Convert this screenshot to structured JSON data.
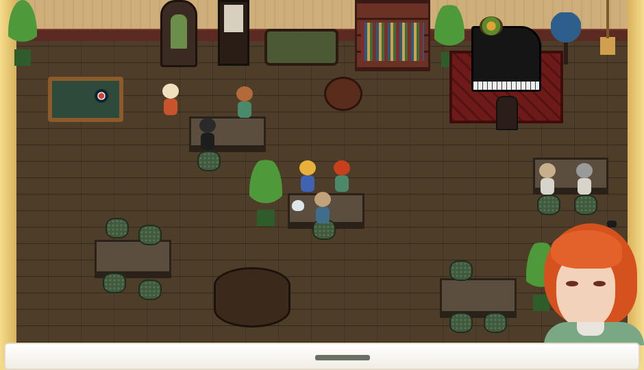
{
  "scene": {
    "name": "tavern-interior",
    "objects": [
      "jukebox",
      "menu-board",
      "sofa",
      "bookshelf",
      "potted-plant",
      "grand-piano",
      "fruit-bowl",
      "globe",
      "broom",
      "pool-table",
      "round-table",
      "barrel",
      "table",
      "stool",
      "teapot",
      "rug"
    ],
    "characters": 8
  },
  "portrait": {
    "hair_color": "#d5521f",
    "shirt_color": "#7ba884"
  },
  "message_window": {
    "text": ""
  },
  "colors": {
    "frame": "#f3d98a",
    "floor": "#4e3e29",
    "wall": "#cfae7a",
    "message_bg": "#ffffff"
  }
}
